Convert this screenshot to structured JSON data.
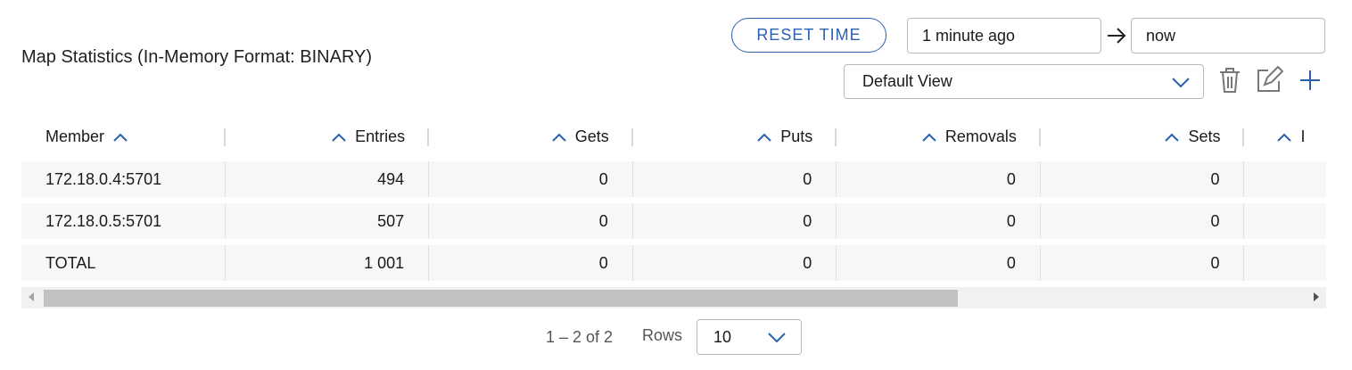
{
  "header": {
    "title": "Map Statistics (In-Memory Format: BINARY)",
    "reset_label": "RESET TIME",
    "time_from": "1 minute ago",
    "time_to": "now",
    "view": "Default View",
    "icons": {
      "arrow": "arrow-right-icon",
      "delete": "trash-icon",
      "edit": "edit-icon",
      "add": "plus-icon"
    },
    "accent_color": "#2b5fb0"
  },
  "table": {
    "columns": [
      "Member",
      "Entries",
      "Gets",
      "Puts",
      "Removals",
      "Sets",
      "I"
    ],
    "rows": [
      {
        "member": "172.18.0.4:5701",
        "entries": "494",
        "gets": "0",
        "puts": "0",
        "removals": "0",
        "sets": "0"
      },
      {
        "member": "172.18.0.5:5701",
        "entries": "507",
        "gets": "0",
        "puts": "0",
        "removals": "0",
        "sets": "0"
      },
      {
        "member": "TOTAL",
        "entries": "1 001",
        "gets": "0",
        "puts": "0",
        "removals": "0",
        "sets": "0"
      }
    ]
  },
  "pagination": {
    "range": "1 – 2 of 2",
    "rows_label": "Rows",
    "rows_value": "10"
  }
}
